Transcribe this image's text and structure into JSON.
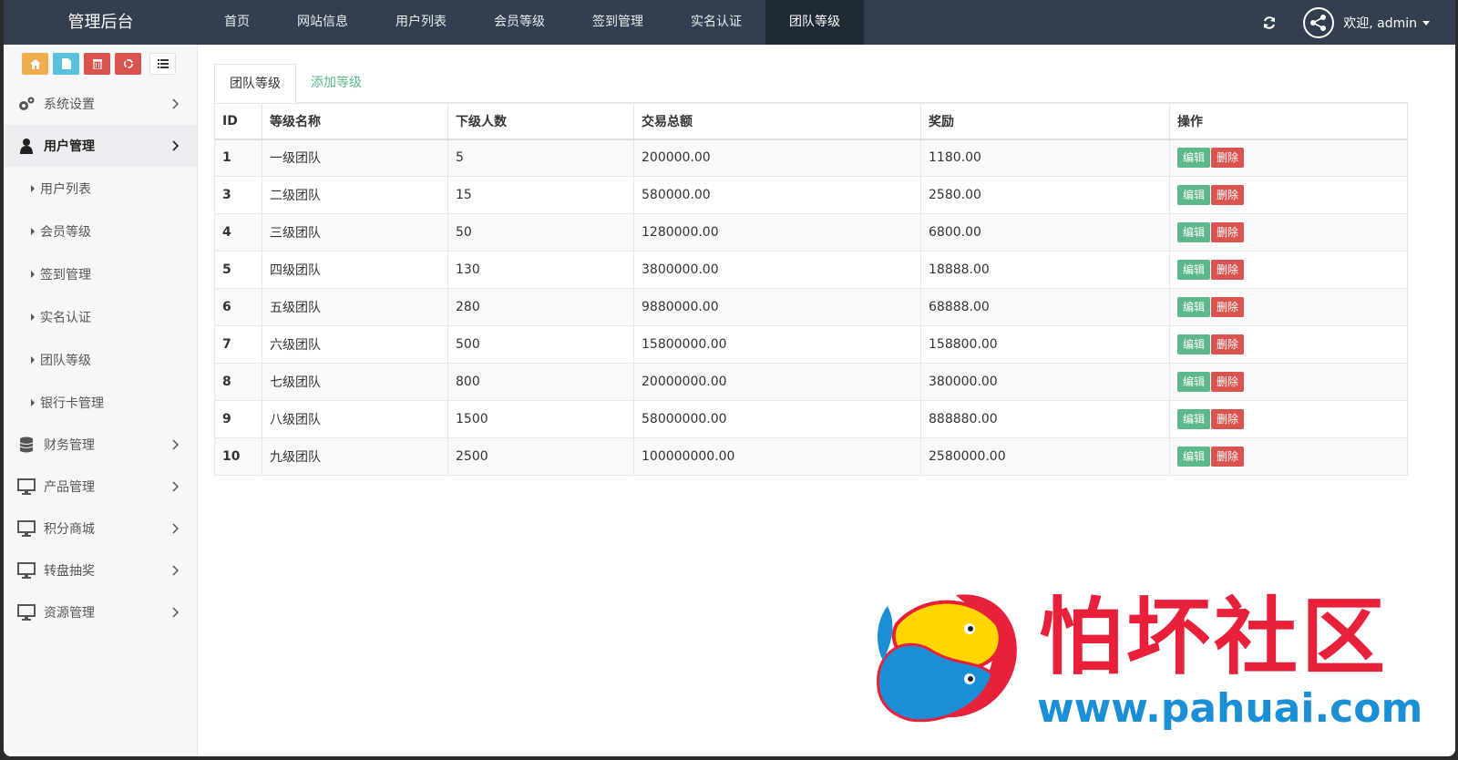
{
  "header": {
    "brand": "管理后台",
    "nav": [
      "首页",
      "网站信息",
      "用户列表",
      "会员等级",
      "签到管理",
      "实名认证",
      "团队等级"
    ],
    "active_nav": 6,
    "welcome": "欢迎, admin"
  },
  "sidebar": {
    "menus_top": [
      {
        "label": "系统设置",
        "icon": "gears-icon"
      },
      {
        "label": "用户管理",
        "icon": "user-icon"
      }
    ],
    "sub_items": [
      "用户列表",
      "会员等级",
      "签到管理",
      "实名认证",
      "团队等级",
      "银行卡管理"
    ],
    "menus_bottom": [
      {
        "label": "财务管理",
        "icon": "database-icon"
      },
      {
        "label": "产品管理",
        "icon": "monitor-icon"
      },
      {
        "label": "积分商城",
        "icon": "monitor-icon"
      },
      {
        "label": "转盘抽奖",
        "icon": "monitor-icon"
      },
      {
        "label": "资源管理",
        "icon": "monitor-icon"
      }
    ]
  },
  "main": {
    "tabs": [
      "团队等级",
      "添加等级"
    ],
    "columns": [
      "ID",
      "等级名称",
      "下级人数",
      "交易总额",
      "奖励",
      "操作"
    ],
    "edit_label": "编辑",
    "delete_label": "删除",
    "rows": [
      {
        "id": "1",
        "name": "一级团队",
        "count": "5",
        "total": "200000.00",
        "reward": "1180.00"
      },
      {
        "id": "3",
        "name": "二级团队",
        "count": "15",
        "total": "580000.00",
        "reward": "2580.00"
      },
      {
        "id": "4",
        "name": "三级团队",
        "count": "50",
        "total": "1280000.00",
        "reward": "6800.00"
      },
      {
        "id": "5",
        "name": "四级团队",
        "count": "130",
        "total": "3800000.00",
        "reward": "18888.00"
      },
      {
        "id": "6",
        "name": "五级团队",
        "count": "280",
        "total": "9880000.00",
        "reward": "68888.00"
      },
      {
        "id": "7",
        "name": "六级团队",
        "count": "500",
        "total": "15800000.00",
        "reward": "158800.00"
      },
      {
        "id": "8",
        "name": "七级团队",
        "count": "800",
        "total": "20000000.00",
        "reward": "380000.00"
      },
      {
        "id": "9",
        "name": "八级团队",
        "count": "1500",
        "total": "58000000.00",
        "reward": "888880.00"
      },
      {
        "id": "10",
        "name": "九级团队",
        "count": "2500",
        "total": "100000000.00",
        "reward": "2580000.00"
      }
    ]
  },
  "watermark": {
    "text": "怕坏社区",
    "url": "www.pahuai.com"
  },
  "colors": {
    "topbar": "#333f4f",
    "edit": "#5cb88a",
    "delete": "#d9534f",
    "watermark_red": "#e8203a",
    "watermark_blue": "#1b8fd6"
  }
}
